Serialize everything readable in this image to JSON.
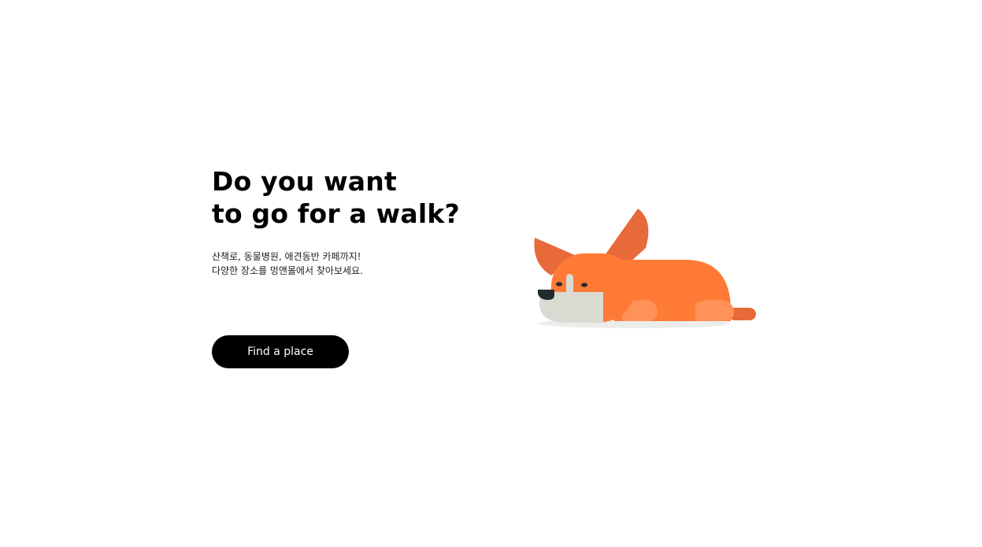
{
  "hero": {
    "title_line1": "Do you want",
    "title_line2": "to go for a walk?",
    "desc_line1": "산책로, 동물병원, 애견동반 카페까지!",
    "desc_line2": "다양한 장소를 멍앤몰에서 찾아보세요.",
    "cta_label": "Find a place"
  },
  "illustration": {
    "icon": "sleeping-dog-illustration",
    "colors": {
      "body": "#FF7A35",
      "ear": "#E8693A",
      "paw": "#FF9257",
      "muzzle": "#D9DBD3",
      "nose": "#222B2E",
      "shadow": "#ECEDEA"
    }
  }
}
